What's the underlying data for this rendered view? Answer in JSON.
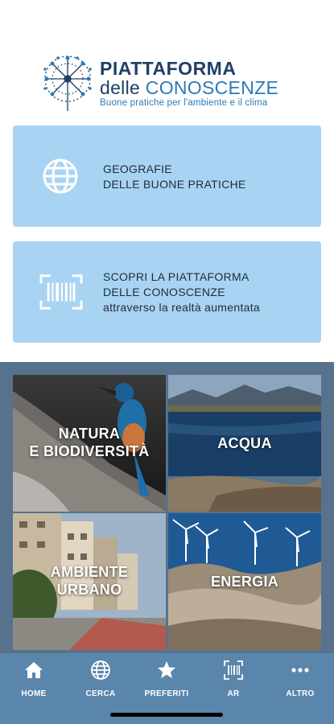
{
  "logo": {
    "title_line1": "PIATTAFORMA",
    "title_line2_a": "delle ",
    "title_line2_b": "CONOSCENZE",
    "tagline": "Buone pratiche per l'ambiente e il clima"
  },
  "cards": [
    {
      "icon": "globe-icon",
      "line1": "GEOGRAFIE",
      "line2": "DELLE BUONE PRATICHE"
    },
    {
      "icon": "barcode-scan-icon",
      "line1": "SCOPRI LA PIATTAFORMA",
      "line2": "DELLE CONOSCENZE",
      "line3": "attraverso la realtà aumentata"
    }
  ],
  "tiles": [
    {
      "line1": "NATURA",
      "line2": "E BIODIVERSITÀ"
    },
    {
      "line1": "ACQUA"
    },
    {
      "line1": "AMBIENTE",
      "line2": "URBANO"
    },
    {
      "line1": "ENERGIA"
    }
  ],
  "tabs": [
    {
      "label": "HOME",
      "icon": "home-icon"
    },
    {
      "label": "CERCA",
      "icon": "globe-icon"
    },
    {
      "label": "PREFERITI",
      "icon": "star-icon"
    },
    {
      "label": "AR",
      "icon": "barcode-scan-icon"
    },
    {
      "label": "ALTRO",
      "icon": "more-icon"
    }
  ],
  "colors": {
    "card_bg": "#a9d3f2",
    "tabbar_bg": "#5b86ab",
    "brand_dark": "#1e3f66",
    "brand_light": "#2c7bb6"
  }
}
